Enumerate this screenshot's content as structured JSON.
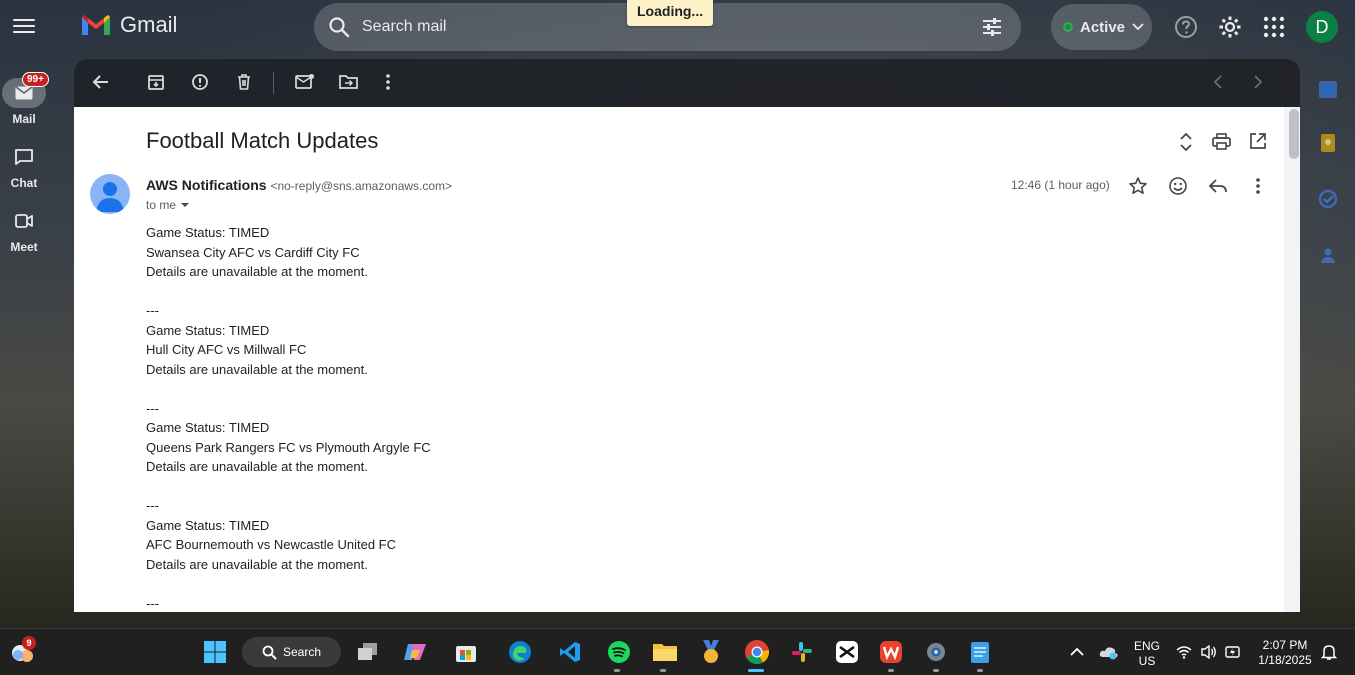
{
  "app": {
    "name": "Gmail"
  },
  "rail": {
    "items": [
      {
        "label": "Mail",
        "badge": "99+"
      },
      {
        "label": "Chat"
      },
      {
        "label": "Meet"
      }
    ]
  },
  "search": {
    "placeholder": "Search mail"
  },
  "loading_text": "Loading...",
  "status": {
    "label": "Active",
    "color": "#1e8e3e"
  },
  "user": {
    "initial": "D",
    "avatar_color": "#0b8043"
  },
  "email": {
    "subject": "Football Match Updates",
    "sender_name": "AWS Notifications",
    "sender_email": "<no-reply@sns.amazonaws.com>",
    "to": "to me",
    "timestamp": "12:46 (1 hour ago)",
    "body": [
      "Game Status: TIMED",
      "Swansea City AFC vs Cardiff City FC",
      "Details are unavailable at the moment.",
      "",
      "---",
      "Game Status: TIMED",
      "Hull City AFC vs Millwall FC",
      "Details are unavailable at the moment.",
      "",
      "---",
      "Game Status: TIMED",
      "Queens Park Rangers FC vs Plymouth Argyle FC",
      "Details are unavailable at the moment.",
      "",
      "---",
      "Game Status: TIMED",
      "AFC Bournemouth vs Newcastle United FC",
      "Details are unavailable at the moment.",
      "",
      "---"
    ]
  },
  "taskbar": {
    "weather_badge": "9",
    "search_label": "Search",
    "lang_line1": "ENG",
    "lang_line2": "US",
    "time": "2:07 PM",
    "date": "1/18/2025"
  }
}
